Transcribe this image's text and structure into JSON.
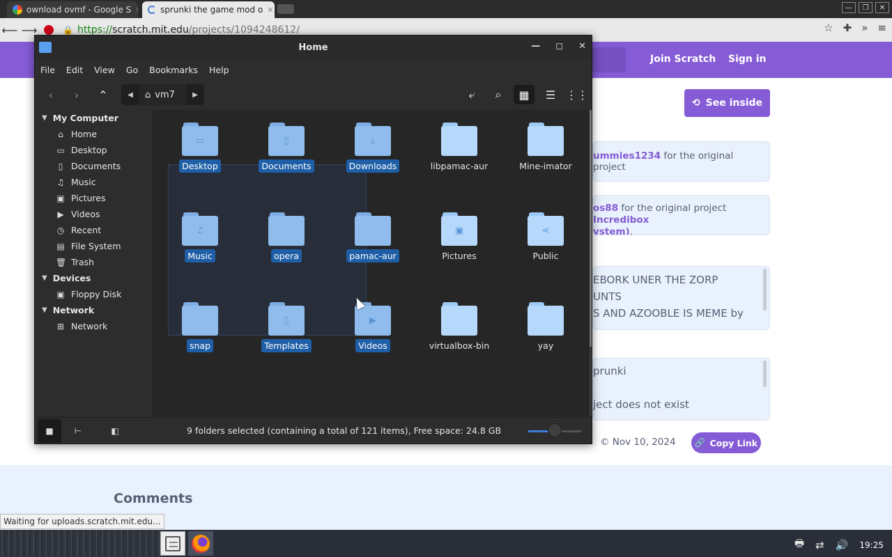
{
  "browser": {
    "tabs": [
      {
        "title": "ownload ovmf - Google S"
      },
      {
        "title": "sprunki the game mod o"
      }
    ],
    "url_scheme": "https://",
    "url_host": "scratch.mit.edu",
    "url_path": "/projects/1094248612/",
    "status_text": "Waiting for uploads.scratch.mit.edu..."
  },
  "scratch": {
    "join": "Join Scratch",
    "signin": "Sign in",
    "see_inside": "See inside",
    "credit1_user": "ummies1234",
    "credit1_rest": " for the original project",
    "credit2_user": "os88",
    "credit2_mid": " for the original project ",
    "credit2_proj": "Incredibox",
    "credit2_proj2": "ystem)",
    "credit2_end": ".",
    "instructions_lines": [
      "EBORK UNER THE ZORP",
      "UNTS",
      "S AND AZOOBLE IS MEME by"
    ],
    "notes_lines": [
      "prunki",
      "",
      "ject does not exist"
    ],
    "date": "Nov 10, 2024",
    "copy_link": "Copy Link",
    "comments": "Comments"
  },
  "filemanager": {
    "title": "Home",
    "menu": [
      "File",
      "Edit",
      "View",
      "Go",
      "Bookmarks",
      "Help"
    ],
    "breadcrumb": "vm7",
    "sidebar": {
      "my_computer": "My Computer",
      "places": [
        {
          "label": "Home",
          "icon": "home-icon"
        },
        {
          "label": "Desktop",
          "icon": "desktop-icon"
        },
        {
          "label": "Documents",
          "icon": "documents-icon"
        },
        {
          "label": "Music",
          "icon": "music-icon"
        },
        {
          "label": "Pictures",
          "icon": "pictures-icon"
        },
        {
          "label": "Videos",
          "icon": "videos-icon"
        },
        {
          "label": "Recent",
          "icon": "recent-icon"
        },
        {
          "label": "File System",
          "icon": "filesystem-icon"
        },
        {
          "label": "Trash",
          "icon": "trash-icon"
        }
      ],
      "devices": "Devices",
      "device_items": [
        {
          "label": "Floppy Disk",
          "icon": "floppy-icon"
        }
      ],
      "network": "Network",
      "network_items": [
        {
          "label": "Network",
          "icon": "network-icon"
        }
      ]
    },
    "items": [
      {
        "label": "Desktop",
        "selected": true,
        "icon": "desktop-folder-icon"
      },
      {
        "label": "Documents",
        "selected": true,
        "icon": "documents-folder-icon"
      },
      {
        "label": "Downloads",
        "selected": true,
        "icon": "downloads-folder-icon"
      },
      {
        "label": "libpamac-aur",
        "selected": false,
        "icon": "folder-icon"
      },
      {
        "label": "Mine-imator",
        "selected": false,
        "icon": "folder-icon"
      },
      {
        "label": "Music",
        "selected": true,
        "icon": "music-folder-icon"
      },
      {
        "label": "opera",
        "selected": true,
        "icon": "folder-icon"
      },
      {
        "label": "pamac-aur",
        "selected": true,
        "icon": "folder-icon"
      },
      {
        "label": "Pictures",
        "selected": false,
        "icon": "pictures-folder-icon"
      },
      {
        "label": "Public",
        "selected": false,
        "icon": "public-folder-icon"
      },
      {
        "label": "snap",
        "selected": true,
        "icon": "folder-icon"
      },
      {
        "label": "Templates",
        "selected": true,
        "icon": "templates-folder-icon"
      },
      {
        "label": "Videos",
        "selected": true,
        "icon": "videos-folder-icon"
      },
      {
        "label": "virtualbox-bin",
        "selected": false,
        "icon": "folder-icon"
      },
      {
        "label": "yay",
        "selected": false,
        "icon": "folder-icon"
      }
    ],
    "status": "9 folders selected (containing a total of 121 items), Free space: 24.8 GB",
    "zoom_level": 0.5
  },
  "taskbar": {
    "clock": "19:25"
  }
}
